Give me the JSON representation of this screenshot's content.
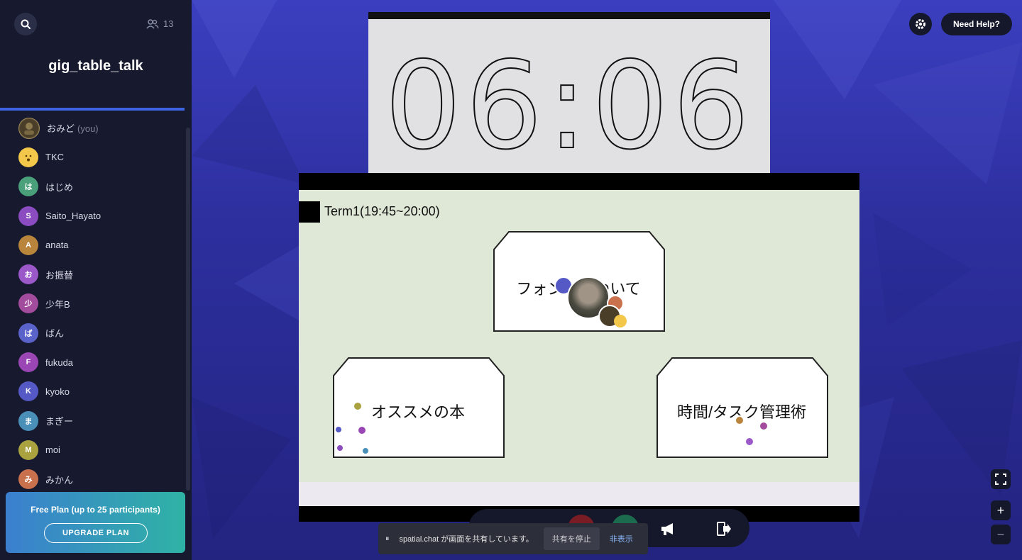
{
  "sidebar": {
    "participant_count": "13",
    "room_title": "gig_table_talk",
    "participants": [
      {
        "name": "おみど",
        "you_tag": "(you)",
        "initial": "",
        "color": "#6b5a3a"
      },
      {
        "name": "TKC",
        "initial": "",
        "color": "#f3c74a"
      },
      {
        "name": "はじめ",
        "initial": "は",
        "color": "#4aa07a"
      },
      {
        "name": "Saito_Hayato",
        "initial": "S",
        "color": "#8a4cc0"
      },
      {
        "name": "anata",
        "initial": "A",
        "color": "#b9853c"
      },
      {
        "name": "お振替",
        "initial": "お",
        "color": "#9b58c9"
      },
      {
        "name": "少年B",
        "initial": "少",
        "color": "#a34b9c"
      },
      {
        "name": "ばん",
        "initial": "ば",
        "color": "#5a63c9"
      },
      {
        "name": "fukuda",
        "initial": "F",
        "color": "#9a47b5"
      },
      {
        "name": "kyoko",
        "initial": "K",
        "color": "#5559c6"
      },
      {
        "name": "まぎー",
        "initial": "ま",
        "color": "#4a8fb8"
      },
      {
        "name": "moi",
        "initial": "M",
        "color": "#a9a23e"
      },
      {
        "name": "みかん",
        "initial": "み",
        "color": "#c9714c"
      }
    ],
    "plan_text": "Free Plan (up to 25 participants)",
    "upgrade_label": "UPGRADE PLAN"
  },
  "topbar": {
    "help_label": "Need Help?"
  },
  "timer": {
    "time": "06:06"
  },
  "slide": {
    "term_title": "Term1(19:45~20:00)",
    "cards": [
      {
        "label": "フォン　　ついて"
      },
      {
        "label": "オススメの本"
      },
      {
        "label": "時間/タスク管理術"
      }
    ]
  },
  "share_notice": {
    "text": "spatial.chat が画面を共有しています。",
    "stop_label": "共有を停止",
    "hide_label": "非表示"
  },
  "colors": {
    "sidebar_bg": "#171a2f",
    "accent": "#3d63e3",
    "stage_bg": "#2d2f9e"
  }
}
